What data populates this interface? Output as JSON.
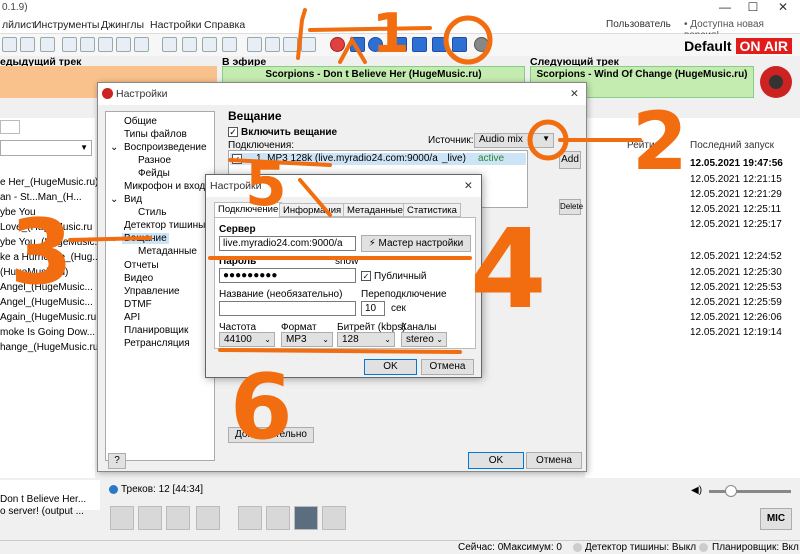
{
  "app": {
    "version": "0.1.9)",
    "brand": "Default",
    "brand_onair": "ON AIR"
  },
  "menu": {
    "items": [
      "лйлист",
      "Инструменты",
      "Джинглы",
      "Настройки",
      "Справка"
    ],
    "user": "Пользователь",
    "update": "• Доступна новая версия!"
  },
  "tracks": {
    "prev_label": "едыдущий трек",
    "current_label": "В эфире",
    "next_label": "Следующий трек",
    "current_title": "Scorpions - Don t Believe Her (HugeMusic.ru)",
    "next_title": "Scorpions - Wind Of Change (HugeMusic.ru)"
  },
  "playlist": [
    "e Her_(HugeMusic.ru)",
    "an - St...Man_(H...",
    "ybe You",
    "Love_(HugeMusic.ru",
    "ybe You_(HugeMusic...",
    "ke a Hurricane_(Hug...",
    "(HugeMusic.ru)",
    "Angel_(HugeMusic...",
    "Angel_(HugeMusic...",
    "Again_(HugeMusic.ru",
    "moke Is Going Dow...",
    "hange_(HugeMusic.ru"
  ],
  "right_list": {
    "col_rating": "Рейтинг",
    "col_last": "Последний запуск",
    "dates": [
      "12.05.2021 19:47:56",
      "12.05.2021 12:21:15",
      "12.05.2021 12:21:29",
      "12.05.2021 12:25:11",
      "12.05.2021 12:25:17",
      "12.05.2021 12:24:52",
      "12.05.2021 12:25:30",
      "12.05.2021 12:25:53",
      "12.05.2021 12:25:59",
      "12.05.2021 12:26:06",
      "12.05.2021 12:19:14"
    ]
  },
  "settings": {
    "title": "Настройки",
    "nav": [
      "Общие",
      "Типы файлов",
      "Воспроизведение",
      "Разное",
      "Фейды",
      "Микрофон и входы",
      "Вид",
      "Стиль",
      "Детектор тишины",
      "Вещание",
      "Метаданные",
      "Отчеты",
      "Видео",
      "Управление",
      "DTMF",
      "API",
      "Планировщик",
      "Ретрансляция"
    ],
    "section_title": "Вещание",
    "enable_label": "Включить вещание",
    "connections_label": "Подключения:",
    "source_label": "Источник:",
    "source_value": "Audio mix",
    "conn_name": "1. MP3 128k (live.myradio24.com:9000/a",
    "conn_name_tail": "_live)",
    "conn_status": "active",
    "add_label": "Add",
    "delete_label": "Delete",
    "extra_label": "Дополнительно",
    "help_label": "?",
    "ok_label": "OK",
    "cancel_label": "Отмена"
  },
  "conn_dialog": {
    "title": "Настройки",
    "tabs": [
      "Подключение",
      "Информация",
      "Метаданные",
      "Статистика"
    ],
    "server_label": "Сервер",
    "server_value": "live.myradio24.com:9000/a",
    "wizard_label": "Мастер настройки",
    "password_label": "Пароль",
    "show_label": "show",
    "password_value": "●●●●●●●●●",
    "public_label": "Публичный",
    "name_label": "Название (необязательно)",
    "reconnect_label": "Переподключение",
    "reconnect_value": "10",
    "reconnect_unit": "сек",
    "freq_label": "Частота",
    "freq_value": "44100",
    "format_label": "Формат",
    "format_value": "MP3",
    "bitrate_label": "Битрейт (kbps)",
    "bitrate_value": "128",
    "channels_label": "Каналы",
    "channels_value": "stereo",
    "ok_label": "OK",
    "cancel_label": "Отмена"
  },
  "bottom": {
    "tracks_info": "Треков: 12 [44:34]",
    "left_line1": "Don t Believe Her...",
    "left_line2": "o server! (output ...",
    "mic_label": "MIC"
  },
  "status": {
    "seconds": "Сейчас: 0",
    "maximum": "Максимум: 0",
    "silence": "Детектор тишины: Выкл",
    "scheduler": "Планировщик: Вкл"
  },
  "annotations": [
    "1",
    "0",
    "0",
    "2",
    "5",
    "4",
    "3",
    "6"
  ],
  "colors": {
    "accent": "#f26d0f",
    "onair": "#e21b1b",
    "current_track_bg": "#c4ecb0",
    "prev_track_bg": "#f9c18c"
  }
}
